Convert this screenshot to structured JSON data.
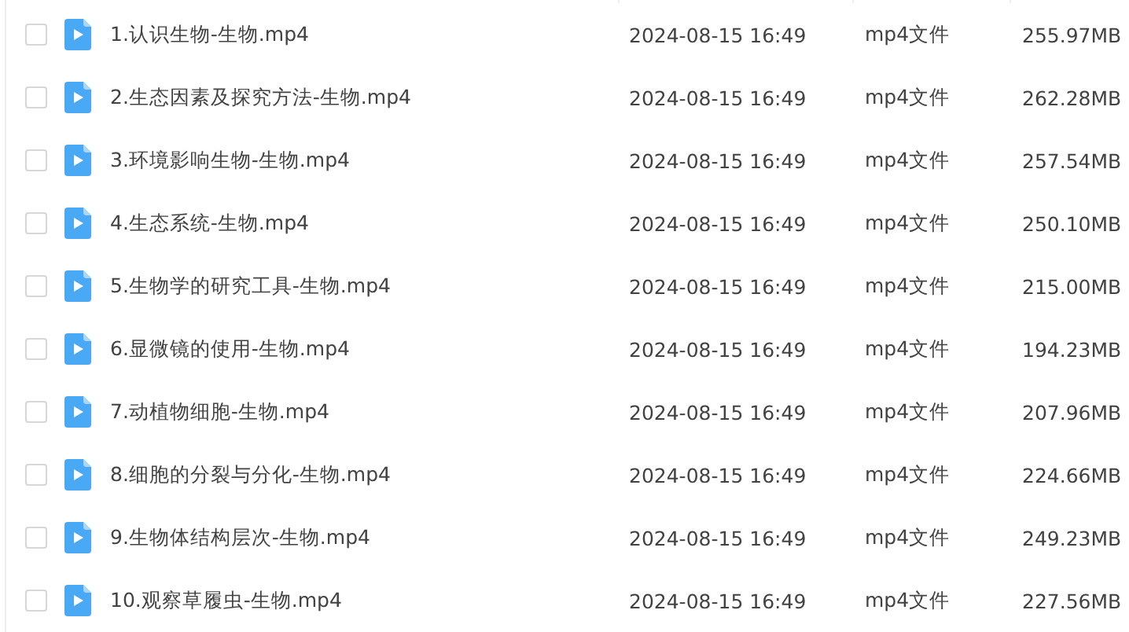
{
  "files": [
    {
      "name": "1.认识生物-生物.mp4",
      "modified": "2024-08-15 16:49",
      "type": "mp4文件",
      "size": "255.97MB",
      "checked": false
    },
    {
      "name": "2.生态因素及探究方法-生物.mp4",
      "modified": "2024-08-15 16:49",
      "type": "mp4文件",
      "size": "262.28MB",
      "checked": false
    },
    {
      "name": "3.环境影响生物-生物.mp4",
      "modified": "2024-08-15 16:49",
      "type": "mp4文件",
      "size": "257.54MB",
      "checked": false
    },
    {
      "name": "4.生态系统-生物.mp4",
      "modified": "2024-08-15 16:49",
      "type": "mp4文件",
      "size": "250.10MB",
      "checked": false
    },
    {
      "name": "5.生物学的研究工具-生物.mp4",
      "modified": "2024-08-15 16:49",
      "type": "mp4文件",
      "size": "215.00MB",
      "checked": false
    },
    {
      "name": "6.显微镜的使用-生物.mp4",
      "modified": "2024-08-15 16:49",
      "type": "mp4文件",
      "size": "194.23MB",
      "checked": false
    },
    {
      "name": "7.动植物细胞-生物.mp4",
      "modified": "2024-08-15 16:49",
      "type": "mp4文件",
      "size": "207.96MB",
      "checked": false
    },
    {
      "name": "8.细胞的分裂与分化-生物.mp4",
      "modified": "2024-08-15 16:49",
      "type": "mp4文件",
      "size": "224.66MB",
      "checked": false
    },
    {
      "name": "9.生物体结构层次-生物.mp4",
      "modified": "2024-08-15 16:49",
      "type": "mp4文件",
      "size": "249.23MB",
      "checked": false
    },
    {
      "name": "10.观察草履虫-生物.mp4",
      "modified": "2024-08-15 16:49",
      "type": "mp4文件",
      "size": "227.56MB",
      "checked": false
    }
  ]
}
